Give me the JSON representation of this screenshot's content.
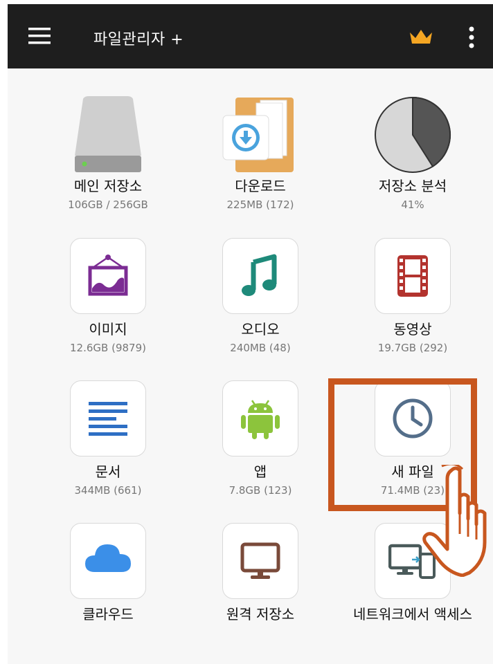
{
  "header": {
    "title": "파일관리자 +",
    "icons": [
      "menu-icon",
      "crown-icon",
      "more-vert-icon"
    ],
    "background": "#1e1e1e",
    "crown_color": "#f5a623"
  },
  "tiles": [
    {
      "label": "메인 저장소",
      "sub": "106GB / 256GB",
      "icon": "hard-drive-icon"
    },
    {
      "label": "다운로드",
      "sub": "225MB (172)",
      "icon": "download-folder-icon"
    },
    {
      "label": "저장소 분석",
      "sub": "41%",
      "icon": "storage-pie-icon",
      "used_fraction": 0.41
    },
    {
      "label": "이미지",
      "sub": "12.6GB (9879)",
      "icon": "image-frame-icon"
    },
    {
      "label": "오디오",
      "sub": "240MB (48)",
      "icon": "music-note-icon"
    },
    {
      "label": "동영상",
      "sub": "19.7GB (292)",
      "icon": "film-strip-icon"
    },
    {
      "label": "문서",
      "sub": "344MB (661)",
      "icon": "document-lines-icon"
    },
    {
      "label": "앱",
      "sub": "7.8GB (123)",
      "icon": "android-icon"
    },
    {
      "label": "새 파일",
      "sub": "71.4MB (23)",
      "icon": "clock-icon"
    },
    {
      "label": "클라우드",
      "sub": "",
      "icon": "cloud-icon"
    },
    {
      "label": "원격 저장소",
      "sub": "",
      "icon": "monitor-icon"
    },
    {
      "label": "네트워크에서 액세스",
      "sub": "",
      "icon": "devices-icon"
    }
  ],
  "colors": {
    "image": "#7b2c93",
    "audio": "#1e8a7a",
    "video": "#b3332e",
    "document": "#2e6fc4",
    "android": "#8cc43c",
    "recent": "#546e8a",
    "cloud": "#3b8fe8",
    "remote": "#7a4a3a",
    "network": "#4a5a5a",
    "annotation": "#c8571f"
  }
}
